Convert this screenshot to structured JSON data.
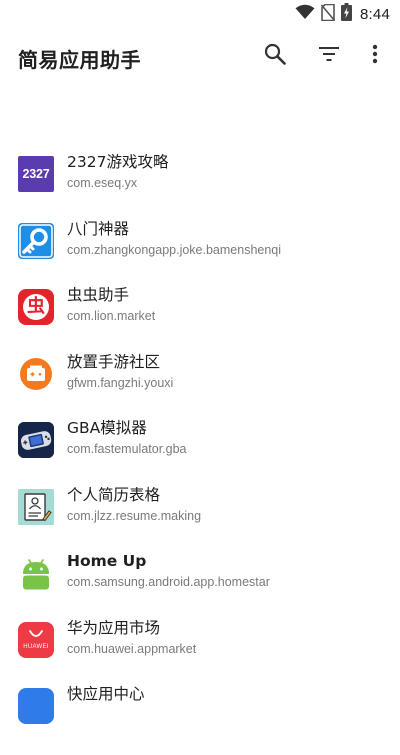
{
  "status_bar": {
    "time": "8:44",
    "icons": [
      "wifi-icon",
      "no-sim-icon",
      "battery-charging-icon"
    ]
  },
  "app_bar": {
    "title": "简易应用助手",
    "actions": [
      "search-icon",
      "filter-icon",
      "more-vert-icon"
    ]
  },
  "apps": [
    {
      "name": "2327游戏攻略",
      "package": "com.eseq.yx",
      "icon": "2327-app-icon",
      "icon_text": "2327",
      "color": "#5a3bb0"
    },
    {
      "name": "八门神器",
      "package": "com.zhangkongapp.joke.bamenshenqi",
      "icon": "bamen-key-icon",
      "color": "#1e90e8"
    },
    {
      "name": "虫虫助手",
      "package": "com.lion.market",
      "icon": "chongchong-icon",
      "icon_text": "虫",
      "color": "#e3242b"
    },
    {
      "name": "放置手游社区",
      "package": "gfwm.fangzhi.youxi",
      "icon": "fangzhi-controller-icon",
      "color": "#f47a1f"
    },
    {
      "name": "GBA模拟器",
      "package": "com.fastemulator.gba",
      "icon": "gba-console-icon",
      "color": "#1a2a4a"
    },
    {
      "name": "个人简历表格",
      "package": "com.jlzz.resume.making",
      "icon": "resume-document-icon",
      "color": "#9fd8d2"
    },
    {
      "name": "Home Up",
      "package": "com.samsung.android.app.homestar",
      "icon": "android-robot-icon",
      "color": "#7cc44a"
    },
    {
      "name": "华为应用市场",
      "package": "com.huawei.appmarket",
      "icon": "huawei-bag-icon",
      "icon_text": "HUAWEI",
      "color": "#ef3b45"
    },
    {
      "name": "快应用中心",
      "package": "",
      "icon": "quickapp-icon",
      "color": "#2f7be8"
    }
  ]
}
